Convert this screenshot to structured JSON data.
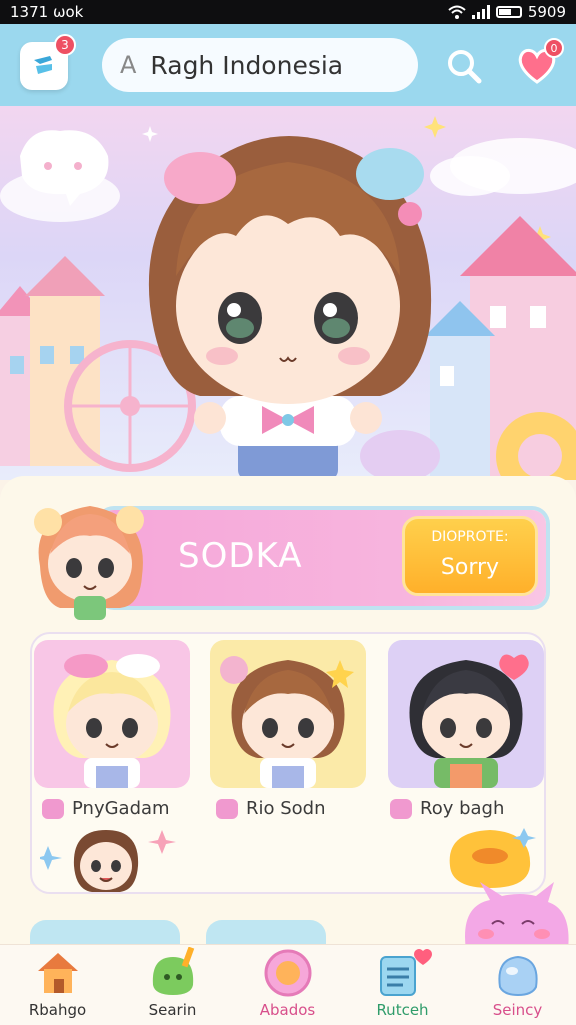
{
  "status_bar": {
    "left_text": "1371 ωok",
    "right_text": "5909"
  },
  "header": {
    "app_badge": "3",
    "search_icon_glyph": "A",
    "search_value": "Ragh Indonesia",
    "favorites_badge": "0"
  },
  "featured": {
    "title": "SODKA",
    "button_line1": "DIOPROTE:",
    "button_line2": "Sorry"
  },
  "characters": [
    {
      "name": "PnyGadam",
      "bg": "#f8c6e6"
    },
    {
      "name": "Rio Sodn",
      "bg": "#fbeaa8"
    },
    {
      "name": "Roy bagh",
      "bg": "#ddd0f5"
    }
  ],
  "bottom_nav": [
    {
      "label": "Rbahgo",
      "color": "#333333"
    },
    {
      "label": "Searin",
      "color": "#333333"
    },
    {
      "label": "Abados",
      "color": "#d84f8b"
    },
    {
      "label": "Rutceh",
      "color": "#2f9c6a"
    },
    {
      "label": "Seincy",
      "color": "#d84f8b"
    }
  ],
  "colors": {
    "header_bg": "#9bd8ee",
    "accent_pink": "#f6a7d9",
    "accent_yellow": "#ffc23a",
    "badge_red": "#ee5063"
  }
}
